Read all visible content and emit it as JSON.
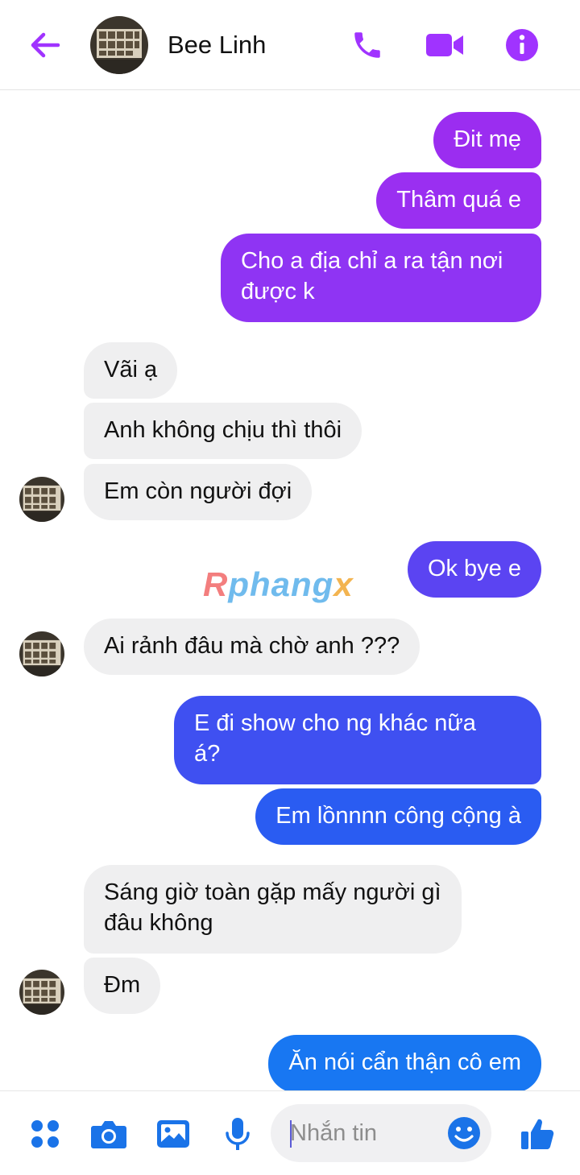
{
  "header": {
    "contact_name": "Bee Linh",
    "back_icon": "arrow-left-icon",
    "call_icon": "phone-icon",
    "video_icon": "video-camera-icon",
    "info_icon": "info-icon"
  },
  "messages": [
    {
      "dir": "out",
      "text": "Đit mẹ"
    },
    {
      "dir": "out",
      "text": "Thâm quá e"
    },
    {
      "dir": "out",
      "line1": "Cho a địa chỉ a ra tận nơi",
      "line2": "được k"
    },
    {
      "dir": "in",
      "text": "Vãi ạ"
    },
    {
      "dir": "in",
      "text": "Anh không chịu thì thôi"
    },
    {
      "dir": "in",
      "text": "Em còn người đợi"
    },
    {
      "dir": "out",
      "text": "Ok bye e"
    },
    {
      "dir": "in",
      "text": "Ai rảnh đâu mà chờ anh ???"
    },
    {
      "dir": "out",
      "line1": "E đi show cho ng khác nữa",
      "line2": "á?"
    },
    {
      "dir": "out",
      "text": "Em lồnnnn công cộng à"
    },
    {
      "dir": "in",
      "line1": "Sáng giờ toàn gặp mấy người gì",
      "line2": "đâu không"
    },
    {
      "dir": "in",
      "text": "Đm"
    },
    {
      "dir": "out",
      "text": "Ăn nói cẩn thận cô em"
    }
  ],
  "watermark": {
    "part1": "R",
    "part2": "phang",
    "part3": "x"
  },
  "composer": {
    "placeholder": "Nhắn tin",
    "icons": [
      "apps-grid-icon",
      "camera-icon",
      "image-icon",
      "microphone-icon",
      "emoji-icon",
      "thumbs-up-icon"
    ]
  },
  "colors": {
    "accent": "#a033ff",
    "bubble_purple": "#9b2df0",
    "bubble_violet": "#5b44f2",
    "bubble_blue": "#2a5cf2",
    "bubble_incoming": "#efeff0"
  }
}
